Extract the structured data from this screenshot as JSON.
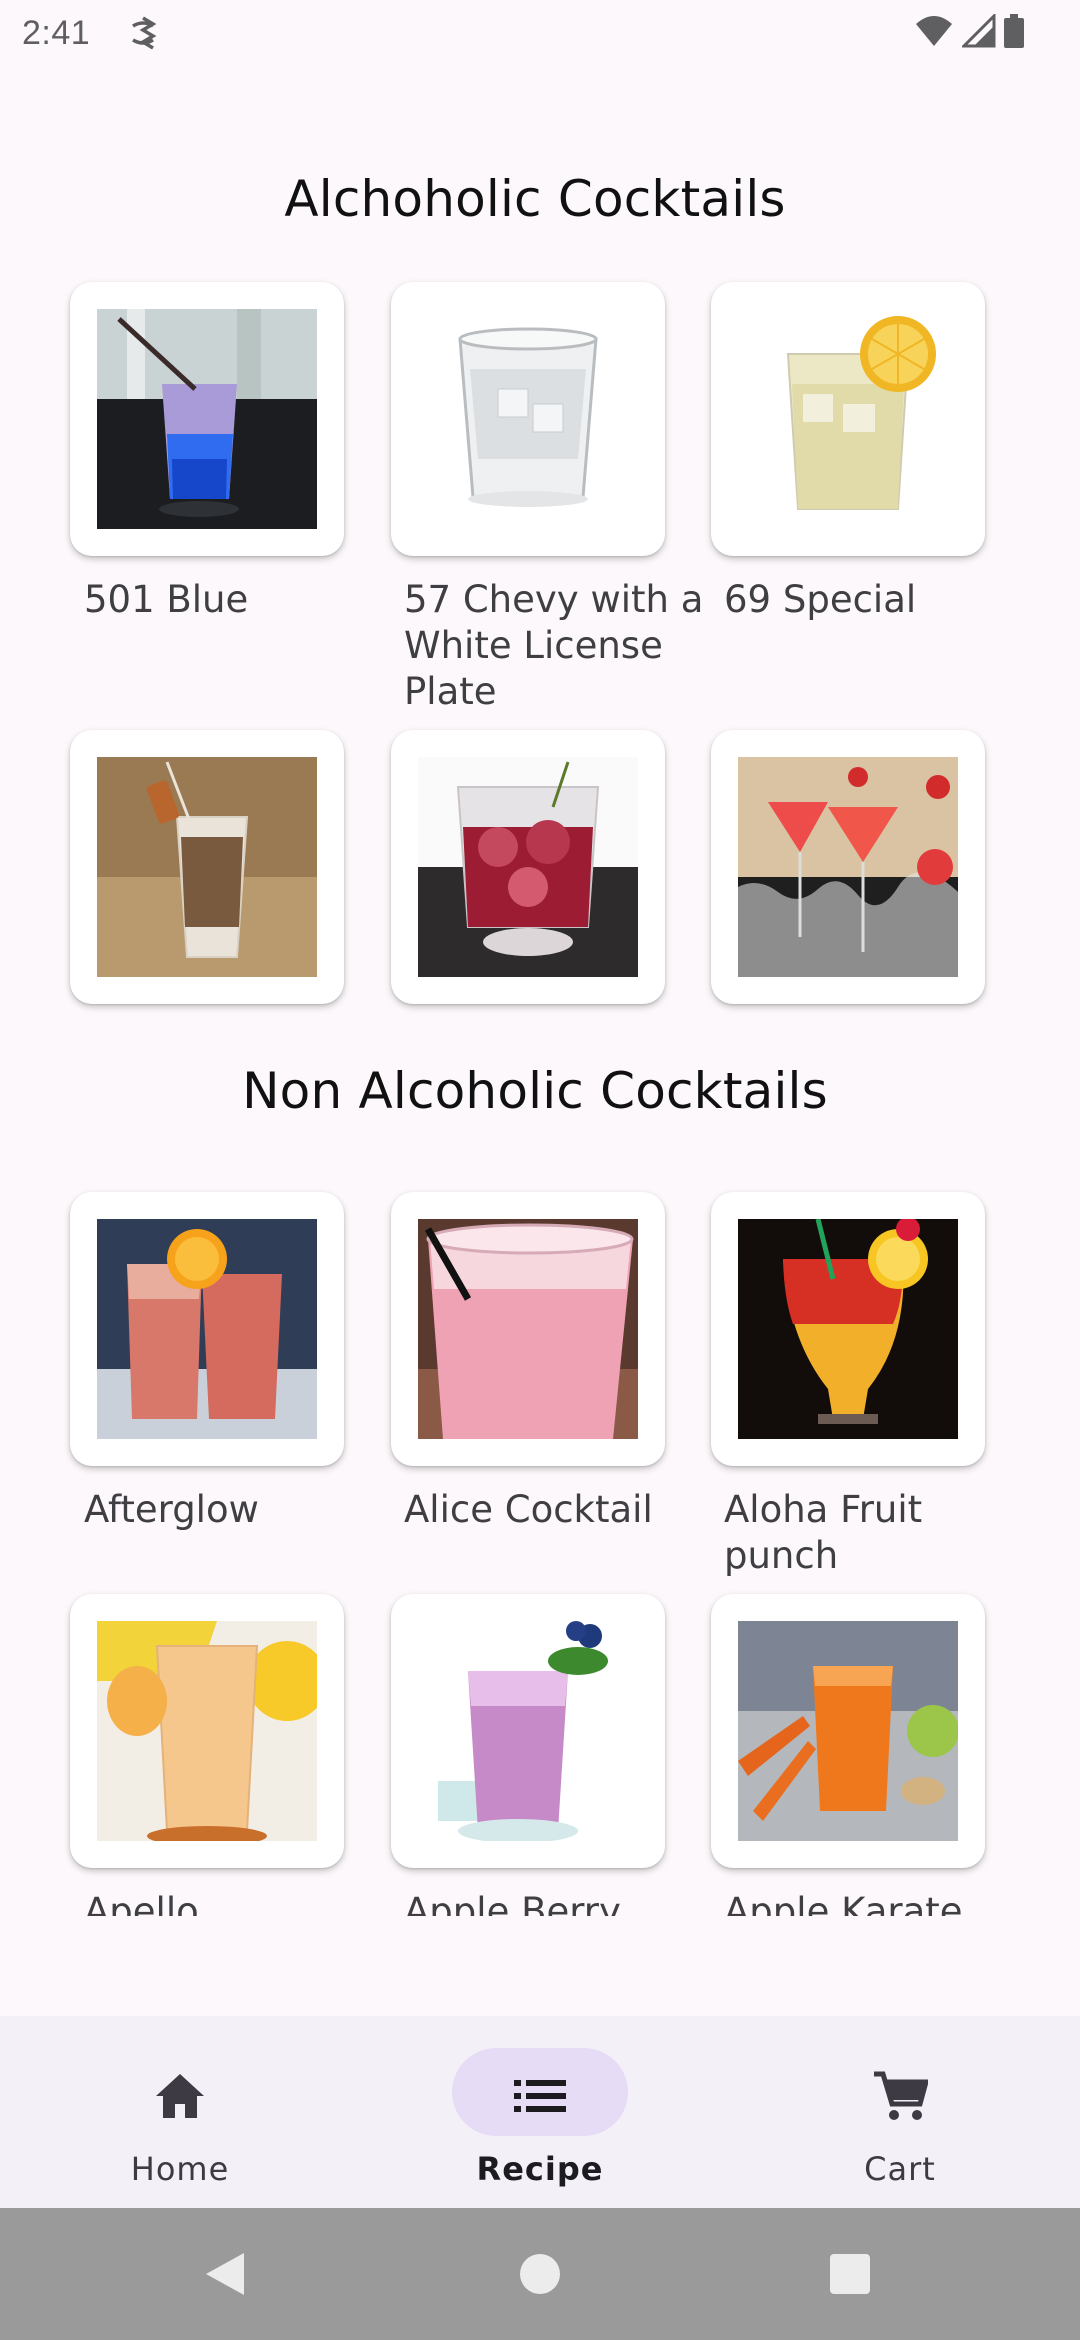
{
  "status_bar": {
    "time": "2:41",
    "icons": [
      "sync-app-icon",
      "wifi-icon",
      "signal-icon",
      "battery-icon"
    ]
  },
  "sections": {
    "alcoholic": {
      "title": "Alchoholic Cocktails",
      "items": [
        {
          "name": "501 Blue",
          "image": "blue-cocktail-glass"
        },
        {
          "name": "57 Chevy with a White License Plate",
          "image": "clear-ice-rocks-glass"
        },
        {
          "name": "69 Special",
          "image": "lemon-highball"
        },
        {
          "name": "",
          "image": "creamy-shot-glass"
        },
        {
          "name": "",
          "image": "red-berry-rocks-glass"
        },
        {
          "name": "",
          "image": "strawberry-martinis"
        }
      ]
    },
    "non_alcoholic": {
      "title": "Non Alcoholic Cocktails",
      "items": [
        {
          "name": "Afterglow",
          "image": "peach-orange-glasses"
        },
        {
          "name": "Alice Cocktail",
          "image": "pink-frothy-drink"
        },
        {
          "name": "Aloha Fruit punch",
          "image": "sunrise-hurricane-glass"
        },
        {
          "name": "Apello",
          "image": "apricot-juice-glass"
        },
        {
          "name": "Apple Berry",
          "image": "berry-smoothie"
        },
        {
          "name": "Apple Karate",
          "image": "carrot-juice"
        }
      ]
    }
  },
  "bottom_nav": {
    "items": [
      {
        "label": "Home",
        "icon": "home-icon",
        "active": false
      },
      {
        "label": "Recipe",
        "icon": "list-icon",
        "active": true
      },
      {
        "label": "Cart",
        "icon": "cart-icon",
        "active": false
      }
    ]
  },
  "colors": {
    "background": "#fcf8fb",
    "nav_background": "#f3f1f7",
    "nav_active_pill": "#e6dcf5",
    "system_nav": "#9a9a9a"
  }
}
